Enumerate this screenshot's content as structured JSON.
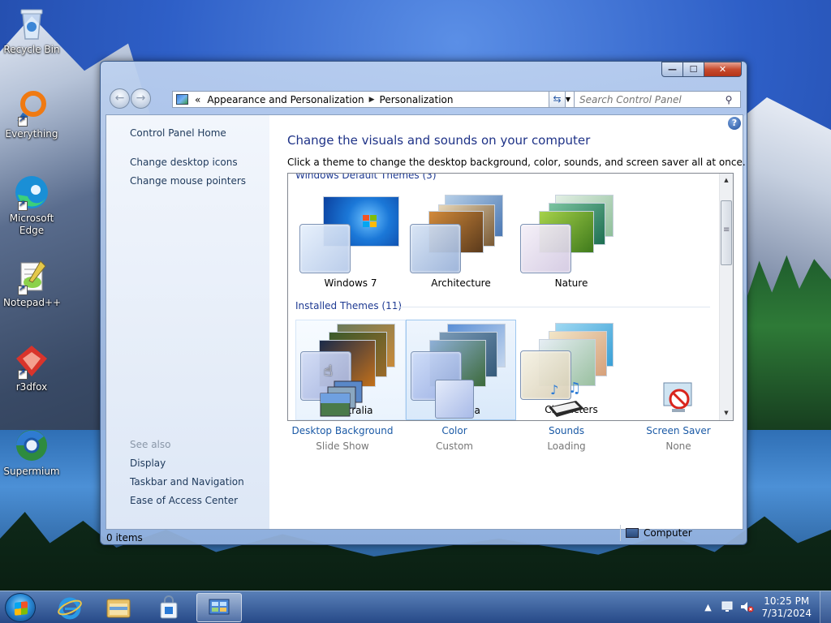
{
  "desktop": {
    "icons": [
      {
        "label": "Recycle Bin"
      },
      {
        "label": "Everything"
      },
      {
        "label": "Microsoft Edge"
      },
      {
        "label": "Notepad++"
      },
      {
        "label": "r3dfox"
      },
      {
        "label": "Supermium"
      }
    ]
  },
  "window": {
    "buttons": {
      "minimize": "—",
      "maximize": "☐",
      "close": "✕"
    },
    "address": {
      "overflow": "«",
      "segments": [
        "Appearance and Personalization",
        "Personalization"
      ]
    },
    "search": {
      "placeholder": "Search Control Panel"
    },
    "left_pane": {
      "home": "Control Panel Home",
      "links": [
        "Change desktop icons",
        "Change mouse pointers"
      ],
      "see_also_title": "See also",
      "see_also": [
        "Display",
        "Taskbar and Navigation",
        "Ease of Access Center"
      ]
    },
    "main": {
      "heading": "Change the visuals and sounds on your computer",
      "subtitle": "Click a theme to change the desktop background, color, sounds, and screen saver all at once.",
      "groups": [
        {
          "title": "Windows Default Themes (3)",
          "themes": [
            "Windows 7",
            "Architecture",
            "Nature"
          ]
        },
        {
          "title": "Installed Themes (11)",
          "themes": [
            "Australia",
            "Canada",
            "Characters"
          ]
        }
      ],
      "settings": [
        {
          "label": "Desktop Background",
          "value": "Slide Show"
        },
        {
          "label": "Color",
          "value": "Custom"
        },
        {
          "label": "Sounds",
          "value": "Loading"
        },
        {
          "label": "Screen Saver",
          "value": "None"
        }
      ]
    },
    "status": {
      "items": "0 items",
      "location": "Computer"
    }
  },
  "taskbar": {
    "clock_time": "10:25 PM",
    "clock_date": "7/31/2024"
  },
  "colors": {
    "link": "#1b5aa6",
    "heading": "#1e3287",
    "close": "#c74b2e"
  }
}
